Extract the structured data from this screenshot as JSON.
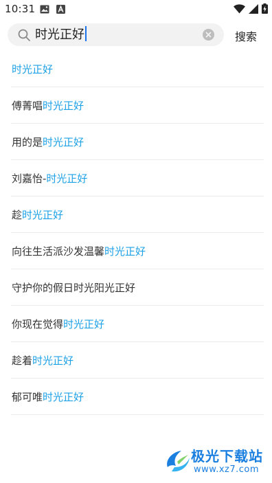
{
  "status_bar": {
    "time": "10:31",
    "icons": [
      "image-icon",
      "a-notification-icon",
      "wifi-icon",
      "signal-icon",
      "battery-charging-icon"
    ]
  },
  "search": {
    "query": "时光正好",
    "button_label": "搜索"
  },
  "suggestions": [
    {
      "prefix": "",
      "match": "时光正好",
      "suffix": ""
    },
    {
      "prefix": "傅菁唱",
      "match": "时光正好",
      "suffix": ""
    },
    {
      "prefix": "用的是",
      "match": "时光正好",
      "suffix": ""
    },
    {
      "prefix": "刘嘉怡-",
      "match": "时光正好",
      "suffix": ""
    },
    {
      "prefix": "趁",
      "match": "时光正好",
      "suffix": ""
    },
    {
      "prefix": "向往生活派沙发温馨",
      "match": "时光正好",
      "suffix": ""
    },
    {
      "prefix": "守护你的假日时光阳光正好",
      "match": "",
      "suffix": ""
    },
    {
      "prefix": "你现在觉得",
      "match": "时光正好",
      "suffix": ""
    },
    {
      "prefix": "趁着",
      "match": "时光正好",
      "suffix": ""
    },
    {
      "prefix": "郁可唯",
      "match": "时光正好",
      "suffix": ""
    }
  ],
  "watermark": {
    "title": "极光下载站",
    "url": "www.xz7.com"
  },
  "colors": {
    "highlight": "#1da1e6",
    "text": "#333333",
    "search_box_bg": "#f2f2f2",
    "caret": "#1a73e8",
    "watermark": "#1b7fe0"
  }
}
